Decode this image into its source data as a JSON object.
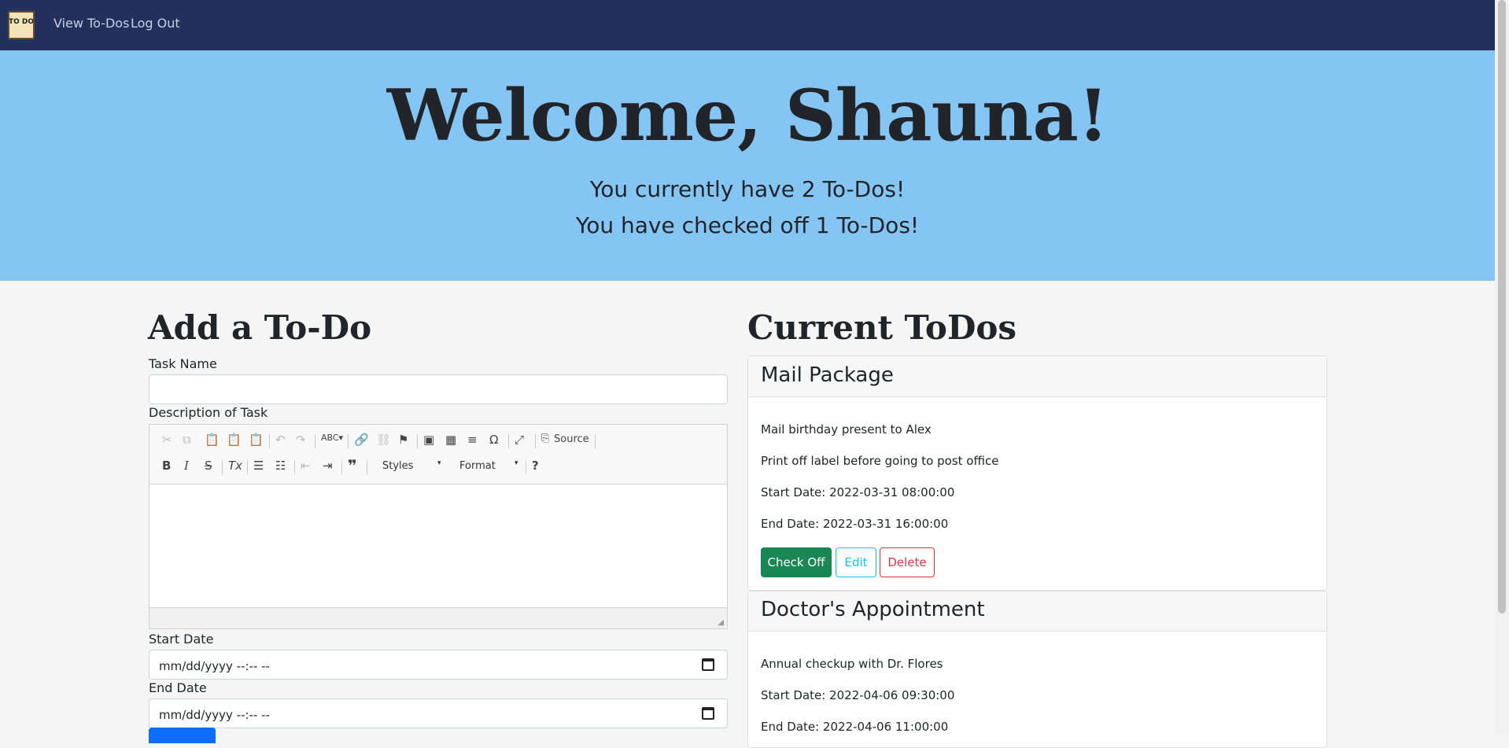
{
  "nav": {
    "logo_text": "TO DO",
    "links": [
      "View To-Dos",
      "Log Out"
    ]
  },
  "hero": {
    "title": "Welcome, Shauna!",
    "count_line": "You currently have 2 To-Dos!",
    "checked_line": "You have checked off 1 To-Dos!"
  },
  "add_form": {
    "title": "Add a To-Do",
    "task_name_label": "Task Name",
    "task_name_value": "",
    "description_label": "Description of Task",
    "editor_toolbar": {
      "source_label": "Source",
      "styles_label": "Styles",
      "format_label": "Format",
      "help_label": "?"
    },
    "start_date_label": "Start Date",
    "start_date_placeholder": "mm/dd/yyyy --:-- --",
    "end_date_label": "End Date",
    "end_date_placeholder": "mm/dd/yyyy --:-- --"
  },
  "current": {
    "title": "Current ToDos",
    "todos": [
      {
        "name": "Mail Package",
        "lines": [
          "Mail birthday present to Alex",
          "Print off label before going to post office"
        ],
        "start": "Start Date: 2022-03-31 08:00:00",
        "end": "End Date: 2022-03-31 16:00:00",
        "buttons": {
          "check": "Check Off",
          "edit": "Edit",
          "delete": "Delete"
        }
      },
      {
        "name": "Doctor's Appointment",
        "lines": [
          "Annual checkup with Dr. Flores"
        ],
        "start": "Start Date: 2022-04-06 09:30:00",
        "end": "End Date: 2022-04-06 11:00:00"
      }
    ]
  },
  "colors": {
    "nav": "#22305c",
    "hero": "#85c5f4",
    "success": "#198754",
    "info": "#0dcaf0",
    "danger": "#dc3545"
  }
}
